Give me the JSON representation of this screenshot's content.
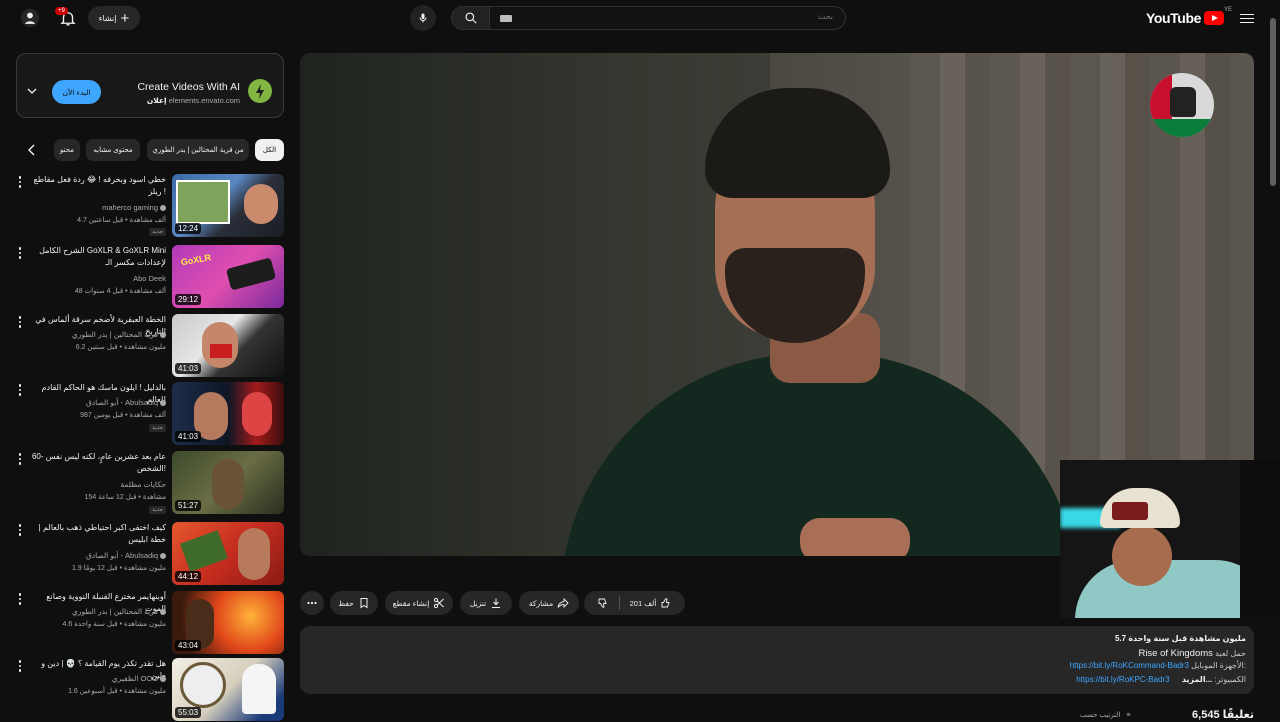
{
  "topbar": {
    "logo_text": "YouTube",
    "country_code": "YE",
    "search_placeholder": "بحث",
    "create_label": "إنشاء",
    "notification_count": "+9"
  },
  "ad": {
    "title": "Create Videos With AI",
    "sponsored": "إعلان",
    "url": "elements.envato.com",
    "cta": "البدء الآن"
  },
  "chips": [
    "الكل",
    "من قرية المحتالين | بدر الطوري",
    "محتوى مشابه",
    "محتو"
  ],
  "recommendations": [
    {
      "title": "خطي اسود وبحرفه ! 😂 ردة فعل مقاطع ريلز !",
      "extra": "😂",
      "channel": "maherco gaming",
      "meta": "4.7 ألف مشاهدة • قبل ساعتين",
      "duration": "12:24",
      "badge": "جديد"
    },
    {
      "title": "الشرح الكامل GoXLR & GoXLR Mini لإعدادات مكسر الـ",
      "channel": "Abo Deek",
      "meta": "48 ألف مشاهدة • قبل 4 سنوات",
      "duration": "29:12"
    },
    {
      "title": "الخطة العبقرية لأضخم سرقة ألماس في التاريخ",
      "channel": "قرية المحتالين | بدر الطوري",
      "meta": "6.2 مليون مشاهدة • قبل سنتين",
      "duration": "41:03"
    },
    {
      "title": "بالدليل ! ايلون ماسك هو الحاكم القادم للعالم",
      "channel": "أبو الصادق - Abulsadiq",
      "meta": "987 ألف مشاهدة • قبل يومين",
      "duration": "41:03",
      "badge": "جديد"
    },
    {
      "title": "60- عام بعد عشرين عامٍ، لكنه ليس نفس الشخص!",
      "channel": "حكايات مظلمة",
      "meta": "154 مشاهدة • قبل 12 ساعة",
      "duration": "51:27",
      "badge": "جديد"
    },
    {
      "title": "كيف اختفى اكبر احتياطي ذهب بالعالم | خطة ابليس",
      "channel": "أبو الصادق - Abulsadiq",
      "meta": "1.9 مليون مشاهدة • قبل 12 يومًا",
      "duration": "44:12"
    },
    {
      "title": "أوبنهايمر مخترع القنبلة النووية وصانع الموت",
      "channel": "قرية المحتالين | بدر الطوري",
      "meta": "4.6 مليون مشاهدة • قبل سنة واحدة",
      "duration": "43:04"
    },
    {
      "title": "هل تقدر تكذر يوم القيامة ؟ 💀 | دين و طين",
      "channel": "الظفيري OOO",
      "meta": "1.6 مليون مشاهدة • قبل أسبوعين",
      "duration": "55:03"
    }
  ],
  "actions": {
    "likes": "201 ألف",
    "share": "مشاركة",
    "download": "تنزيل",
    "clip": "إنشاء مقطع",
    "save": "حفظ"
  },
  "description": {
    "stats": "5.7 مليون مشاهدة  قبل سنة واحدة",
    "line2_prefix": "حمل لعبة",
    "line2_game": "Rise of Kingdoms",
    "line3_label": "الأجهزة الموبايل:",
    "line3_link": "https://bit.ly/RoKCommand-Badr3",
    "line4_label": "الكمبيوتر:",
    "line4_link": "https://bit.ly/RoKPC-Badr3",
    "more": "...المزيد"
  },
  "comments": {
    "count": "6,545 تعليقًا",
    "sort": "الترتيب حسب"
  },
  "colors": {
    "accent": "#3ea6ff",
    "brand_red": "#ff0000",
    "background": "#0f0f0f",
    "surface": "#272727"
  }
}
